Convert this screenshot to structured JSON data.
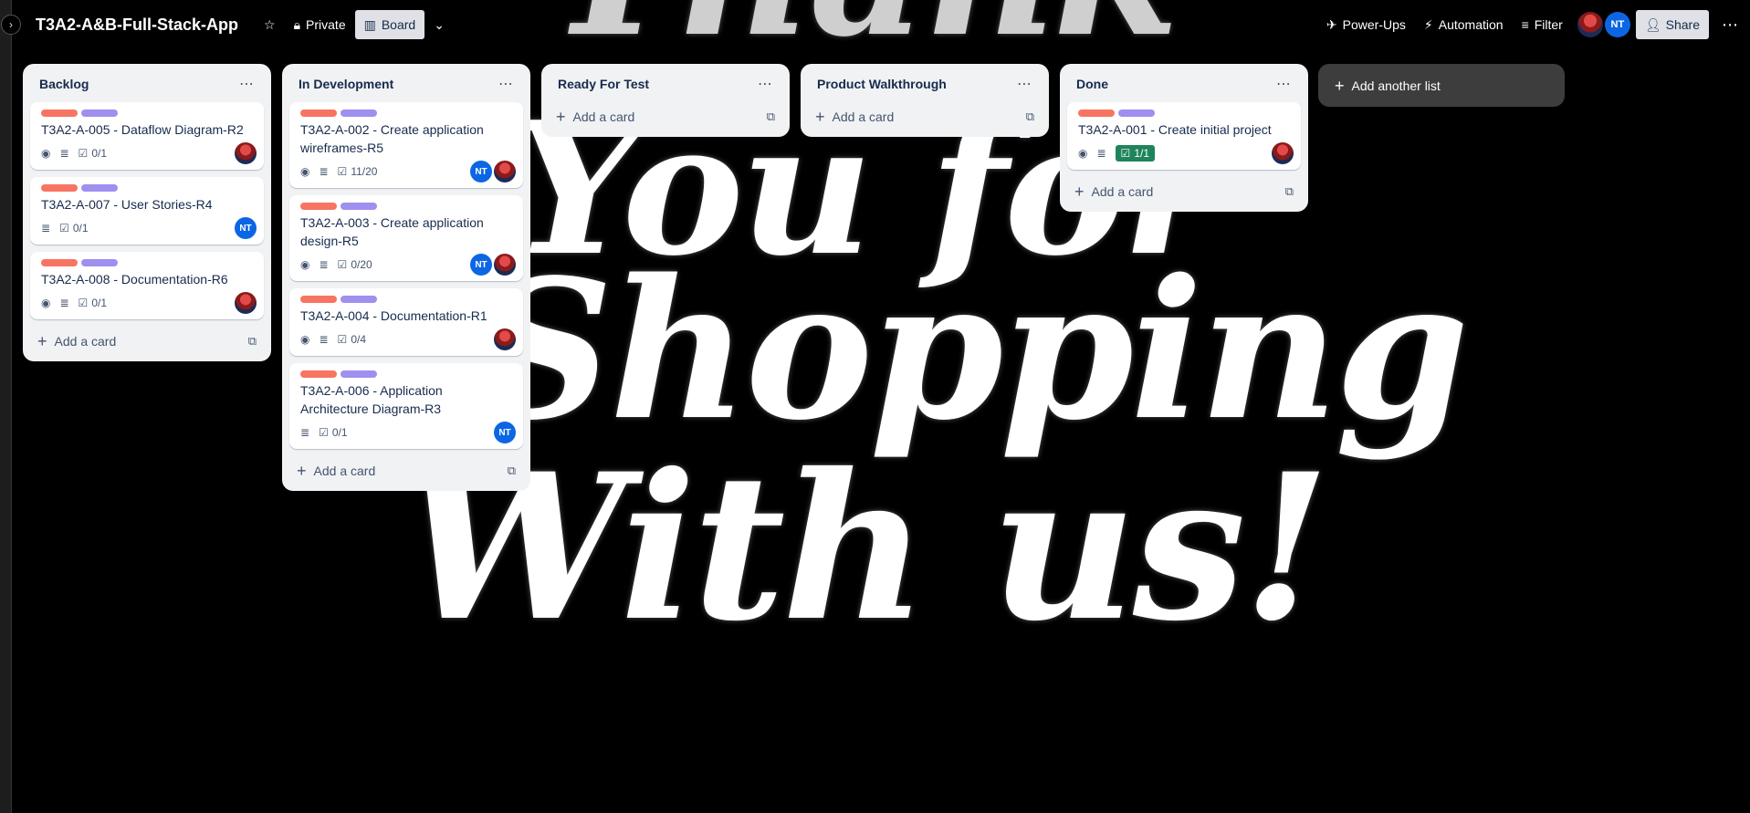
{
  "background_art": {
    "lines": [
      "Thank",
      "You for",
      "Shopping",
      "With us!"
    ]
  },
  "header": {
    "board_title": "T3A2-A&B-Full-Stack-App",
    "visibility_label": "Private",
    "board_view_label": "Board",
    "power_ups_label": "Power-Ups",
    "automation_label": "Automation",
    "filter_label": "Filter",
    "member_initials": "NT",
    "share_label": "Share"
  },
  "add_card_label": "Add a card",
  "add_list_label": "Add another list",
  "lists": [
    {
      "title": "Backlog",
      "cards": [
        {
          "title": "T3A2-A-005 - Dataflow Diagram-R2",
          "checklist": "0/1"
        },
        {
          "title": "T3A2-A-007 - User Stories-R4",
          "checklist": "0/1",
          "avatar": "NT"
        },
        {
          "title": "T3A2-A-008 - Documentation-R6",
          "checklist": "0/1"
        }
      ]
    },
    {
      "title": "In Development",
      "cards": [
        {
          "title": "T3A2-A-002 - Create application wireframes-R5",
          "checklist": "11/20",
          "avatar": "NT"
        },
        {
          "title": "T3A2-A-003 - Create application design-R5",
          "checklist": "0/20",
          "avatar": "NT"
        },
        {
          "title": "T3A2-A-004 - Documentation-R1",
          "checklist": "0/4"
        },
        {
          "title": "T3A2-A-006 - Application Architecture Diagram-R3",
          "checklist": "0/1",
          "avatar": "NT"
        }
      ]
    },
    {
      "title": "Ready For Test",
      "cards": []
    },
    {
      "title": "Product Walkthrough",
      "cards": []
    },
    {
      "title": "Done",
      "cards": [
        {
          "title": "T3A2-A-001 - Create initial project",
          "checklist": "1/1"
        }
      ]
    }
  ],
  "colors": {
    "label_red": "#f87462",
    "label_purple": "#9f8fef",
    "checklist_complete": "#1f845a",
    "avatar_blue": "#0c66e4"
  }
}
